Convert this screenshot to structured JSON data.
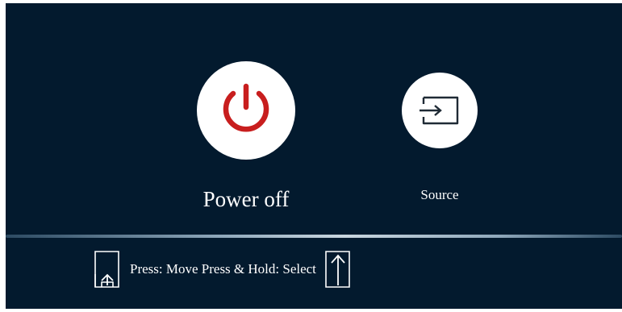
{
  "menu": {
    "power": {
      "label": "Power off",
      "icon": "power-icon",
      "icon_color": "#c81e1e"
    },
    "source": {
      "label": "Source",
      "icon": "source-input-icon",
      "icon_color": "#1f2a35"
    }
  },
  "hint_bar": {
    "text": "Press: Move Press & Hold: Select",
    "left_icon": "press-move-icon",
    "right_icon": "hold-select-icon"
  },
  "colors": {
    "background": "#031a2e",
    "text": "#ffffff",
    "button_fill": "#ffffff",
    "power_accent": "#c81e1e"
  }
}
